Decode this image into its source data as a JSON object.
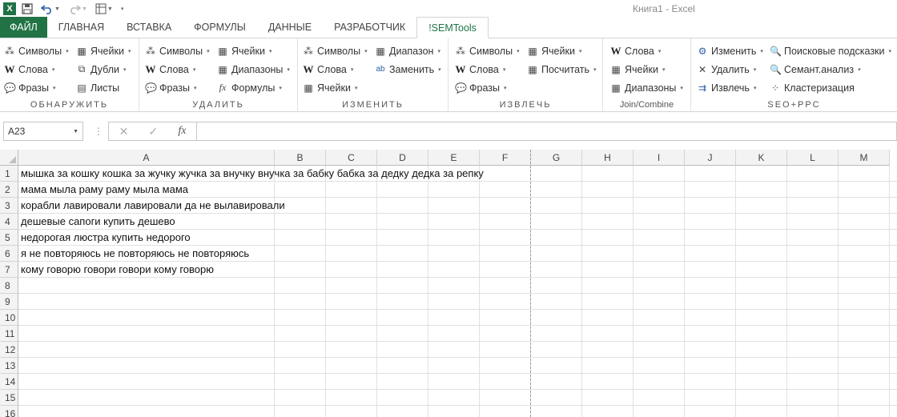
{
  "window": {
    "title": "Книга1 - Excel",
    "app_icon": "X"
  },
  "qat": {
    "icons": [
      "save-icon",
      "undo-icon",
      "redo-icon",
      "custom-icon",
      "customize-qat-icon"
    ]
  },
  "tabs": [
    {
      "label": "ФАЙЛ"
    },
    {
      "label": "ГЛАВНАЯ"
    },
    {
      "label": "ВСТАВКА"
    },
    {
      "label": "ФОРМУЛЫ"
    },
    {
      "label": "ДАННЫЕ"
    },
    {
      "label": "РАЗРАБОТЧИК"
    },
    {
      "label": "!SEMTools"
    }
  ],
  "ribbon": {
    "g1": {
      "label": "ОБНАРУЖИТЬ",
      "c1": [
        "Символы",
        "Слова",
        "Фразы"
      ],
      "c2": [
        "Ячейки",
        "Дубли",
        "Листы"
      ]
    },
    "g2": {
      "label": "УДАЛИТЬ",
      "c1": [
        "Символы",
        "Слова",
        "Фразы"
      ],
      "c2": [
        "Ячейки",
        "Диапазоны",
        "Формулы"
      ]
    },
    "g3": {
      "label": "ИЗМЕНИТЬ",
      "c1": [
        "Символы",
        "Слова",
        "Ячейки"
      ],
      "c2": [
        "Диапазон",
        "Заменить"
      ]
    },
    "g4": {
      "label": "ИЗВЛЕЧЬ",
      "c1": [
        "Символы",
        "Слова",
        "Фразы"
      ],
      "c2": [
        "Ячейки",
        "Посчитать"
      ]
    },
    "g5": {
      "label": "Join/Combine",
      "c1": [
        "Слова",
        "Ячейки",
        "Диапазоны"
      ]
    },
    "g6": {
      "label": "SEO+PPC",
      "c1": [
        "Изменить",
        "Удалить",
        "Извлечь"
      ],
      "c2": [
        "Поисковые подсказки",
        "Семант.анализ",
        "Кластеризация"
      ]
    }
  },
  "formula_bar": {
    "name_box": "A23",
    "formula": "",
    "cancel": "✕",
    "enter": "✓",
    "fx": "fx"
  },
  "columns": [
    "A",
    "B",
    "C",
    "D",
    "E",
    "F",
    "G",
    "H",
    "I",
    "J",
    "K",
    "L",
    "M"
  ],
  "rows": [
    "1",
    "2",
    "3",
    "4",
    "5",
    "6",
    "7",
    "8",
    "9",
    "10",
    "11",
    "12",
    "13",
    "14",
    "15",
    "16"
  ],
  "cells": [
    "мышка за кошку кошка за жучку жучка за внучку внучка за бабку бабка за дедку дедка за репку",
    "мама мыла раму раму мыла мама",
    "корабли лавировали лавировали да не вылавировали",
    "дешевые сапоги купить дешево",
    "недорогая люстра купить недорого",
    "я не повторяюсь не повторяюсь не повторяюсь",
    "кому говорю говори говори кому говорю"
  ]
}
